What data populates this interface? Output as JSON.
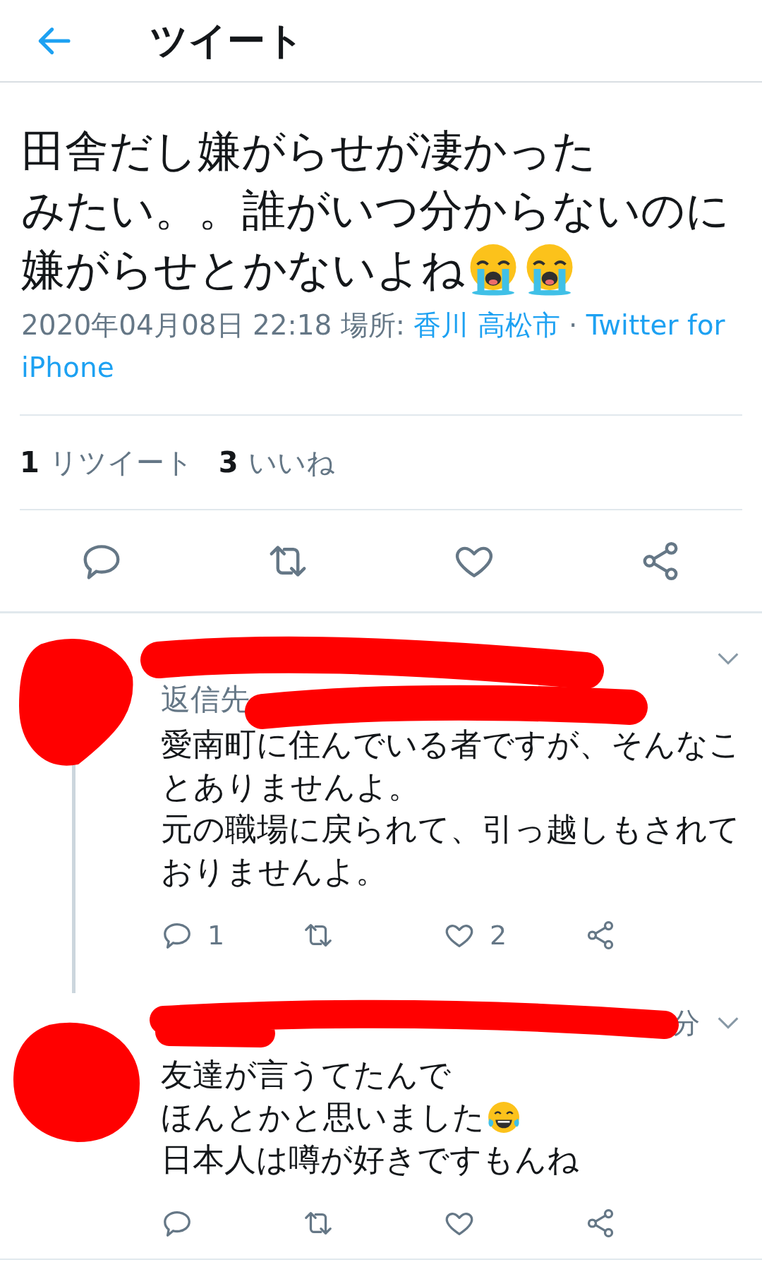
{
  "header": {
    "title": "ツイート"
  },
  "tweet": {
    "lines": [
      {
        "text": "田舎だし嫌がらせが凄かった"
      },
      {
        "text": "みたい。。誰がいつ分からないのに"
      },
      {
        "text": "嫌がらせとかないよね",
        "emojis": [
          {
            "kind": "crying"
          },
          {
            "kind": "crying"
          }
        ]
      }
    ],
    "timestamp": "2020年04月08日 22:18",
    "location_label": "場所:",
    "location": "香川 高松市",
    "separator": "·",
    "source": "Twitter for iPhone",
    "stats": [
      {
        "count": "1",
        "label": "リツイート"
      },
      {
        "count": "3",
        "label": "いいね"
      }
    ],
    "actions": [
      {
        "kind": "reply"
      },
      {
        "kind": "retweet"
      },
      {
        "kind": "like"
      },
      {
        "kind": "share"
      }
    ]
  },
  "replies": [
    {
      "reply_to": "返信先",
      "lines": [
        {
          "text": "愛南町に住んでいる者ですが、そんなこ"
        },
        {
          "text": "とありませんよ。"
        },
        {
          "text": "元の職場に戻られて、引っ越しもされて"
        },
        {
          "text": "おりませんよ。"
        }
      ],
      "actions": [
        {
          "kind": "reply",
          "count": "1"
        },
        {
          "kind": "retweet"
        },
        {
          "kind": "like",
          "count": "2"
        },
        {
          "kind": "share"
        }
      ]
    },
    {
      "time": "分",
      "lines": [
        {
          "text": "友達が言うてたんで"
        },
        {
          "text": "ほんとかと思いました",
          "emojis": [
            {
              "kind": "joy"
            }
          ]
        },
        {
          "text": "日本人は噂が好きですもんね"
        }
      ],
      "actions": [
        {
          "kind": "reply"
        },
        {
          "kind": "retweet"
        },
        {
          "kind": "like"
        },
        {
          "kind": "share"
        }
      ]
    }
  ]
}
